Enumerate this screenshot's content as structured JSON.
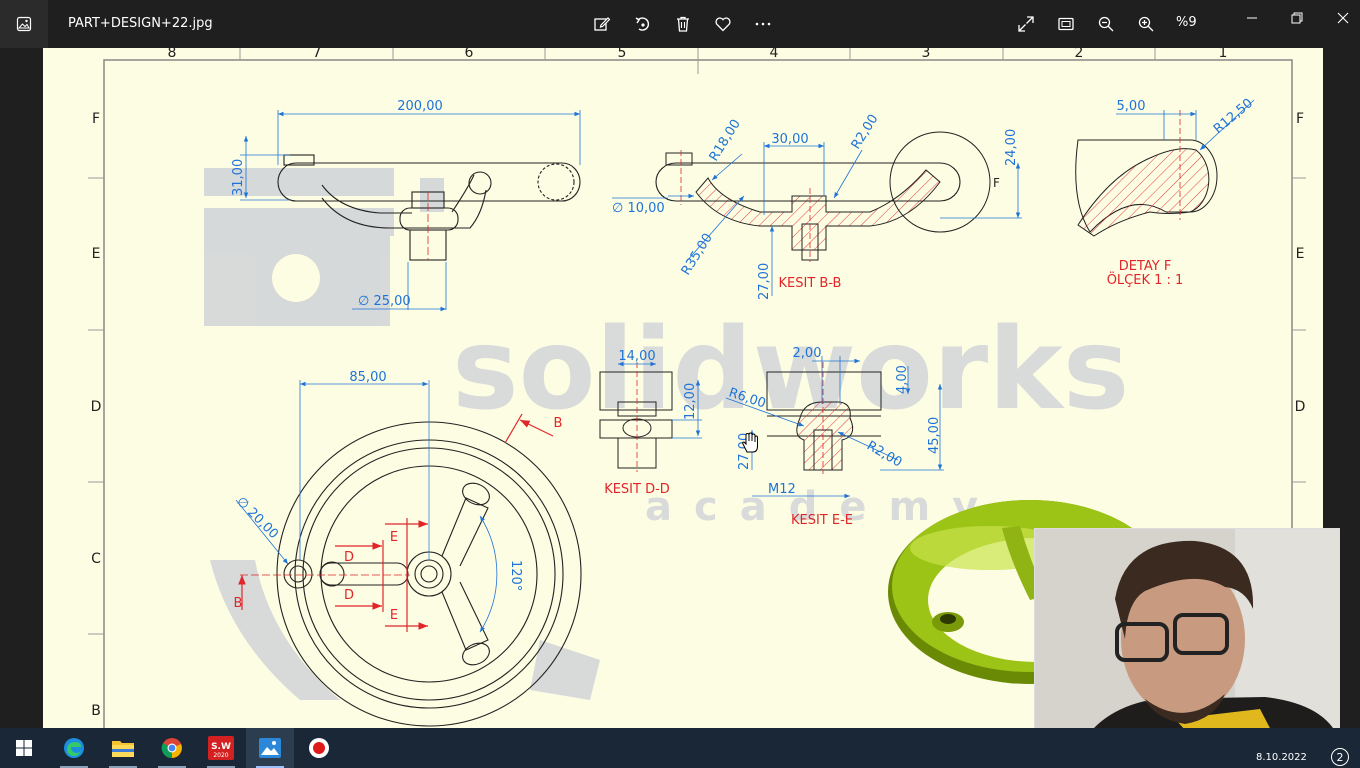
{
  "titlebar": {
    "file_name": "PART+DESIGN+22.jpg",
    "zoom": "%9"
  },
  "drawing": {
    "columns": [
      "8",
      "7",
      "6",
      "5",
      "4",
      "3",
      "2",
      "1"
    ],
    "rows": [
      "F",
      "E",
      "D",
      "C",
      "B"
    ],
    "dims": {
      "d200": "200,00",
      "d31": "31,00",
      "d25": "∅ 25,00",
      "d10": "∅ 10,00",
      "r18": "R18,00",
      "d30": "30,00",
      "r2a": "R2,00",
      "d24": "24,00",
      "r35": "R35,00",
      "d27a": "27,00",
      "f": "F",
      "d5": "5,00",
      "r125": "R12,50",
      "d85": "85,00",
      "d20": "∅ 20,00",
      "d120": "120°",
      "d14": "14,00",
      "d12": "12,00",
      "d2": "2,00",
      "d4": "4,00",
      "r6": "R6,00",
      "r2b": "R2,00",
      "d45": "45,00",
      "d27b": "27,00",
      "m12": "M12"
    },
    "labels": {
      "section_bb": "KESIT B-B",
      "detail_f": "DETAY F",
      "scale_f": "ÖLÇEK 1 : 1",
      "section_dd": "KESIT D-D",
      "section_ee": "KESIT E-E",
      "b": "B",
      "d": "D",
      "e": "E"
    },
    "watermark": {
      "line1": "solidworks",
      "line2": "academy"
    }
  },
  "taskbar": {
    "clock": "8.10.2022",
    "notifications": "2",
    "sw_badge": "2020"
  },
  "colors": {
    "paper": "#fdfde3",
    "dimension": "#1e73d8",
    "section": "#e0262a",
    "titlebar": "#1f1f1f",
    "taskbar": "#1a2736"
  }
}
